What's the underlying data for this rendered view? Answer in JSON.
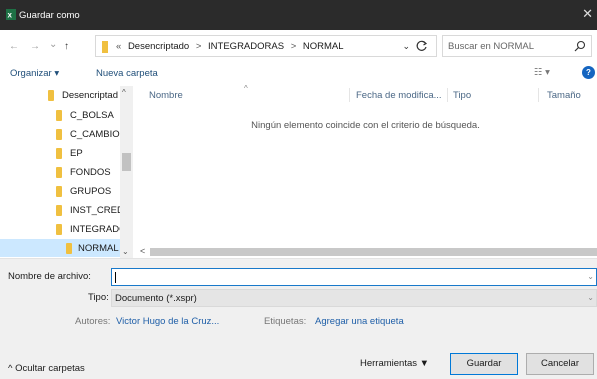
{
  "window": {
    "title": "Guardar como",
    "app_icon": "excel-icon",
    "close_glyph": "✕"
  },
  "nav": {
    "back_glyph": "←",
    "forward_glyph": "→",
    "recent_glyph": "⌄",
    "up_glyph": "↑",
    "overflow_glyph": "«",
    "breadcrumb": [
      "Desencriptado",
      "INTEGRADORAS",
      "NORMAL"
    ],
    "separator": ">",
    "dropdown_glyph": "⌄",
    "search_placeholder": "Buscar en NORMAL"
  },
  "toolbar": {
    "organize_label": "Organizar ▾",
    "new_folder_label": "Nueva carpeta",
    "view_label": "☷ ▾",
    "help_label": "?"
  },
  "tree": {
    "items": [
      {
        "label": "Desencriptad"
      },
      {
        "label": "C_BOLSA"
      },
      {
        "label": "C_CAMBIO"
      },
      {
        "label": "EP"
      },
      {
        "label": "FONDOS"
      },
      {
        "label": "GRUPOS"
      },
      {
        "label": "INST_CREDI"
      },
      {
        "label": "INTEGRADC"
      },
      {
        "label": "NORMAL",
        "selected": true
      }
    ],
    "scroll_up": "^",
    "scroll_down": "⌄"
  },
  "columns": {
    "name": "Nombre",
    "modified": "Fecha de modifica...",
    "type": "Tipo",
    "size": "Tamaño",
    "sort_glyph": "^"
  },
  "empty_message": "Ningún elemento coincide con el criterio de búsqueda.",
  "hscroll_left": "<",
  "form": {
    "filename_label": "Nombre de archivo:",
    "filename_value": "",
    "type_label": "Tipo:",
    "type_value": "Documento (*.xspr)",
    "combo_glyph": "⌄",
    "authors_label": "Autores:",
    "authors_value": "Victor Hugo de la Cruz...",
    "tags_label": "Etiquetas:",
    "tags_value": "Agregar una etiqueta"
  },
  "footer": {
    "hide_folders": "^ Ocultar carpetas",
    "tools": "Herramientas ▼",
    "save": "Guardar",
    "cancel": "Cancelar"
  },
  "colors": {
    "titlebar": "#2b2b2b",
    "link": "#1f4e79",
    "accent": "#0078d7",
    "folder": "#f0c040",
    "selection": "#cce8ff"
  }
}
